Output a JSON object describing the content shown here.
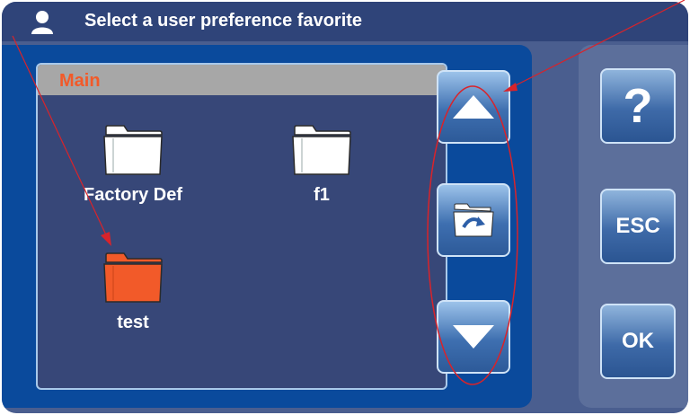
{
  "title": "Select a user preference favorite",
  "browser": {
    "header": "Main"
  },
  "folders": [
    {
      "label": "Factory Def",
      "selected": false
    },
    {
      "label": "f1",
      "selected": false
    },
    {
      "label": "test",
      "selected": true
    }
  ],
  "nav": {
    "up_icon": "triangle-up-icon",
    "open_icon": "folder-open-icon",
    "down_icon": "triangle-down-icon"
  },
  "side": {
    "help_label": "?",
    "esc_label": "ESC",
    "ok_label": "OK"
  },
  "colors": {
    "accent": "#f25a29",
    "panel": "#0a4a9c",
    "browser_bg": "#374778",
    "annotation": "#d9232a"
  }
}
